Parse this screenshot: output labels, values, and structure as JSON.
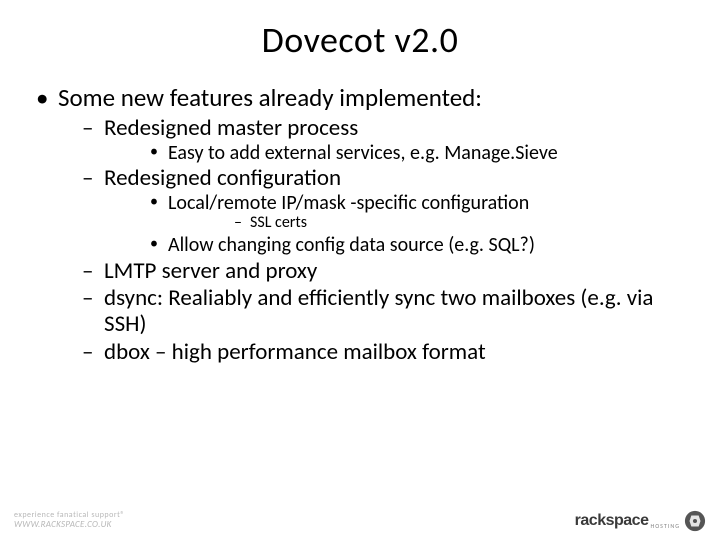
{
  "title": "Dovecot v2.0",
  "bullets": {
    "l1_0": "Some new features already implemented:",
    "l2_0": "Redesigned master process",
    "l3_0": "Easy to add external services, e.g. Manage.Sieve",
    "l2_1": "Redesigned configuration",
    "l3_1": "Local/remote IP/mask -specific configuration",
    "l4_0": "SSL certs",
    "l3_2": "Allow changing config data source (e.g. SQL?)",
    "l2_2": "LMTP server and proxy",
    "l2_3": "dsync: Realiably and efficiently sync two mailboxes (e.g. via SSH)",
    "l2_4": "dbox – high performance mailbox format"
  },
  "footer": {
    "left_top": "experience fanatical support®",
    "left_bottom": "WWW.RACKSPACE.CO.UK",
    "right_brand": "rackspace",
    "right_sub": "HOSTING"
  }
}
